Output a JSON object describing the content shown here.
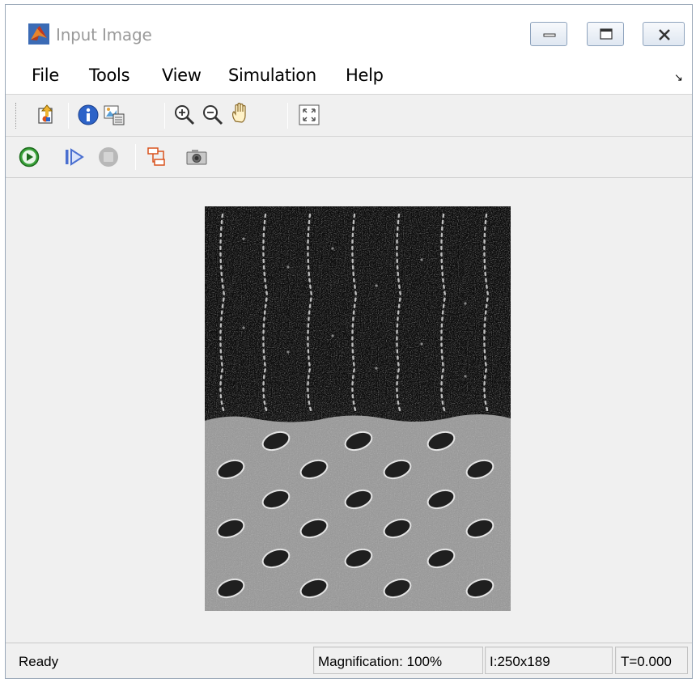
{
  "window": {
    "title": "Input Image",
    "minimize_label": "minimize",
    "maximize_label": "maximize",
    "close_label": "close"
  },
  "menu": {
    "items": [
      {
        "label": "File"
      },
      {
        "label": "Tools"
      },
      {
        "label": "View"
      },
      {
        "label": "Simulation"
      },
      {
        "label": "Help"
      }
    ],
    "overflow_icon": "menu-overflow-arrow-icon"
  },
  "toolbar1": {
    "icons": [
      "parent-model-icon",
      "info-icon",
      "image-properties-icon",
      "zoom-in-icon",
      "zoom-out-icon",
      "pan-hand-icon",
      "fit-to-view-icon"
    ]
  },
  "toolbar2": {
    "icons": [
      "run-icon",
      "step-forward-icon",
      "stop-icon",
      "highlight-model-icon",
      "snapshot-icon"
    ]
  },
  "image": {
    "description_icon": "texture-image",
    "colors": {
      "dark_fabric": "#151515",
      "light_fabric": "#9b9b9b"
    }
  },
  "status": {
    "ready": "Ready",
    "magnification": "Magnification: 100%",
    "dimensions": "I:250x189",
    "time": "T=0.000"
  },
  "colors": {
    "window_bg": "#f0f0f0",
    "title_text": "#9a9a9a",
    "matlab_orange": "#d9531e",
    "run_green": "#2e9b2e",
    "step_blue": "#4a6fd0"
  }
}
